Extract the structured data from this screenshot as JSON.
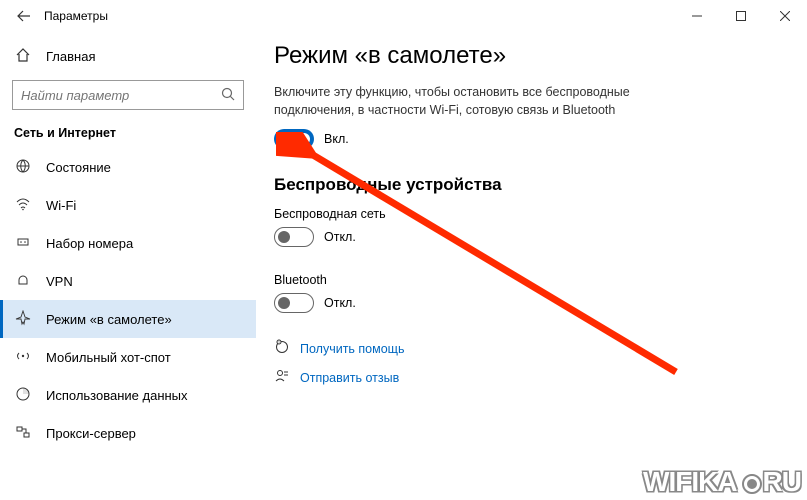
{
  "window": {
    "title": "Параметры"
  },
  "sidebar": {
    "home": "Главная",
    "search_placeholder": "Найти параметр",
    "category": "Сеть и Интернет",
    "items": [
      {
        "icon": "status",
        "label": "Состояние"
      },
      {
        "icon": "wifi",
        "label": "Wi-Fi"
      },
      {
        "icon": "dialup",
        "label": "Набор номера"
      },
      {
        "icon": "vpn",
        "label": "VPN"
      },
      {
        "icon": "airplane",
        "label": "Режим «в самолете»"
      },
      {
        "icon": "hotspot",
        "label": "Мобильный хот-спот"
      },
      {
        "icon": "data",
        "label": "Использование данных"
      },
      {
        "icon": "proxy",
        "label": "Прокси-сервер"
      }
    ]
  },
  "main": {
    "heading": "Режим «в самолете»",
    "description": "Включите эту функцию, чтобы остановить все беспроводные подключения, в частности Wi-Fi, сотовую связь и Bluetooth",
    "airplane_toggle": {
      "state": "on",
      "label": "Вкл."
    },
    "section_heading": "Беспроводные устройства",
    "wireless": {
      "wifi": {
        "title": "Беспроводная сеть",
        "state": "off",
        "label": "Откл."
      },
      "bt": {
        "title": "Bluetooth",
        "state": "off",
        "label": "Откл."
      }
    },
    "links": {
      "help": "Получить помощь",
      "feedback": "Отправить отзыв"
    }
  },
  "watermark": {
    "a": "WIFIKA",
    "b": "RU"
  }
}
